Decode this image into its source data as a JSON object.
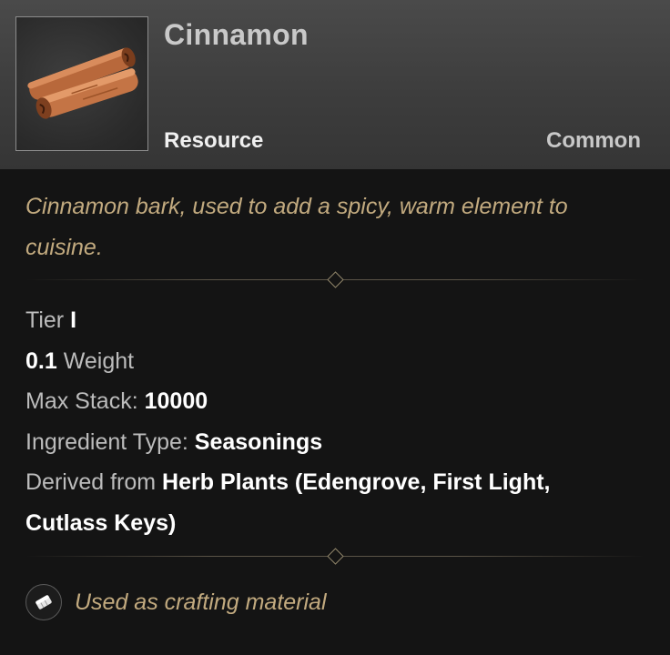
{
  "item": {
    "name": "Cinnamon",
    "type": "Resource",
    "rarity": "Common",
    "icon": "cinnamon-sticks-icon",
    "description": "Cinnamon bark, used to add a spicy, warm element to cuisine."
  },
  "stats": {
    "tier_label": "Tier",
    "tier_value": "I",
    "weight_value": "0.1",
    "weight_label": "Weight",
    "max_stack_label": "Max Stack:",
    "max_stack_value": "10000",
    "ingredient_label": "Ingredient Type:",
    "ingredient_value": "Seasonings",
    "derived_label": "Derived from",
    "derived_value_line1": "Herb Plants (Edengrove, First Light,",
    "derived_value_line2": "Cutlass Keys)"
  },
  "footer": {
    "icon": "crafting-material-icon",
    "text": "Used as crafting material"
  },
  "colors": {
    "flavor_text": "#c2aa7f",
    "header_bg": "#3d3d3d",
    "body_bg": "#141414"
  }
}
